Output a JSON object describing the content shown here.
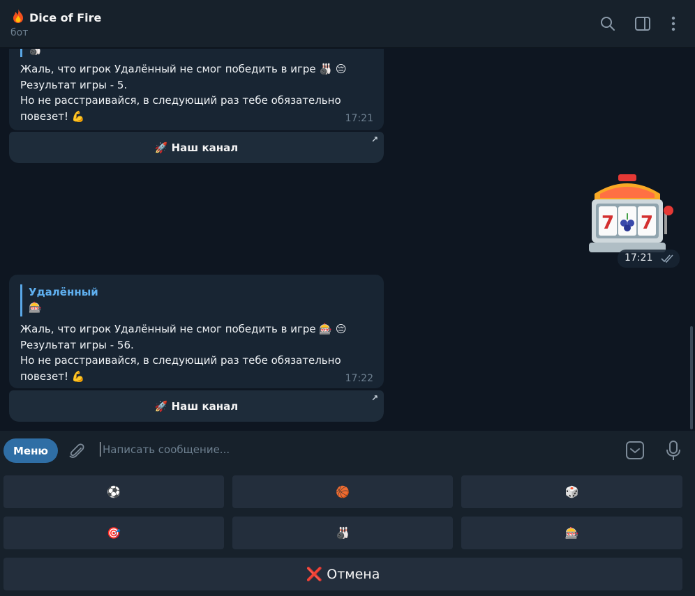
{
  "header": {
    "title": "Dice of Fire",
    "title_icon": "fire",
    "subtitle": "бот",
    "actions": [
      "search-icon",
      "sidebar-toggle-icon",
      "more-vertical-icon"
    ]
  },
  "messages": [
    {
      "reply_to_emoji": "🎳",
      "text_lines": [
        "Жаль, что игрок Удалённый не смог победить в игре 🎳 😔",
        "Результат игры - 5.",
        "Но не расстраивайся, в следующий раз тебе обязательно",
        "повезет! 💪"
      ],
      "time": "17:21",
      "button": "🚀 Наш канал"
    },
    {
      "outgoing": true,
      "sticker": "slot-machine-777",
      "time": "17:21",
      "status": "read"
    },
    {
      "reply_to_name": "Удалённый",
      "reply_to_emoji": "🎰",
      "text_lines": [
        "Жаль, что игрок Удалённый не смог победить в игре 🎰 😔",
        "Результат игры - 56.",
        "Но не расстраивайся, в следующий раз тебе обязательно",
        "повезет! 💪"
      ],
      "time": "17:22",
      "button": "🚀 Наш канал"
    }
  ],
  "input": {
    "menu_label": "Меню",
    "placeholder": "Написать сообщение..."
  },
  "keyboard": {
    "row1": [
      "⚽",
      "🏀",
      "🎲"
    ],
    "row2": [
      "🎯",
      "🎳",
      "🎰"
    ],
    "cancel_label": "Отмена",
    "cancel_icon": "❌"
  }
}
